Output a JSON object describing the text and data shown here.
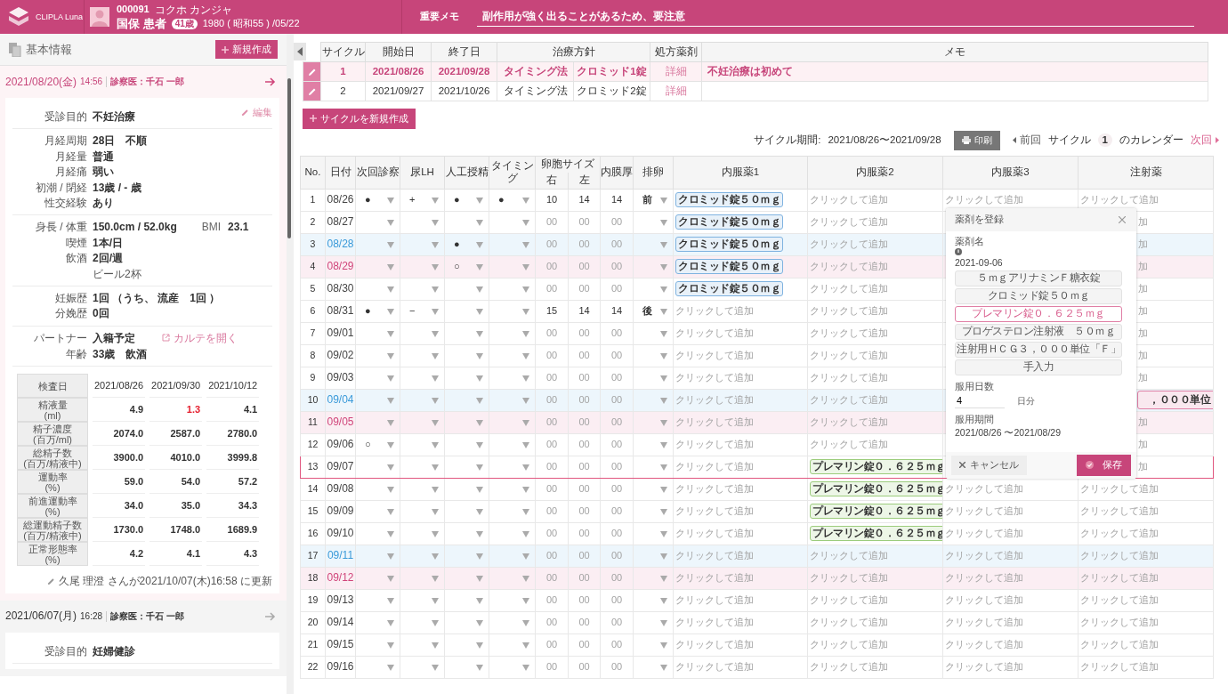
{
  "header": {
    "app_name": "CLIPLA Luna",
    "patient_id": "000091",
    "patient_kana": "コクホ カンジャ",
    "patient_name": "国保 患者",
    "age": "41歳",
    "birthday": "1980 ( 昭和55 ) /05/22",
    "memo_label": "重要メモ",
    "memo": "副作用が強く出ることがあるため、要注意"
  },
  "sidebar": {
    "title": "基本情報",
    "new_button": "新規作成",
    "records": [
      {
        "date": "2021/08/20(金)",
        "time": "14:56",
        "doctor": "診察医：千石 一郎",
        "current": true,
        "edit": "編集",
        "sections": [
          [
            {
              "label": "受診目的",
              "value": "不妊治療"
            }
          ],
          [
            {
              "label": "月経周期",
              "value": "28日　不順"
            },
            {
              "label": "月経量",
              "value": "普通"
            },
            {
              "label": "月経痛",
              "value": "弱い"
            },
            {
              "label": "初潮 / 閉経",
              "value": "13歳  /  - 歳"
            },
            {
              "label": "性交経験",
              "value": "あり"
            }
          ],
          [
            {
              "label": "身長 / 体重",
              "value": "150.0cm  /  52.0kg",
              "extra_label": "BMI",
              "extra_value": "23.1"
            },
            {
              "label": "喫煙",
              "value": "1本/日"
            },
            {
              "label": "飲酒",
              "value": "2回/週",
              "note": "ビール2杯"
            }
          ],
          [
            {
              "label": "妊娠歴",
              "value": "1回 （うち、 流産　1回 ）"
            },
            {
              "label": "分娩歴",
              "value": "0回"
            }
          ],
          [
            {
              "label": "パートナー",
              "value": "入籍予定",
              "link": "カルテを開く"
            },
            {
              "label": "年齢",
              "value": "33歳　飲酒"
            }
          ]
        ],
        "lab": {
          "corner": "検査日",
          "dates": [
            "2021/08/26",
            "2021/09/30",
            "2021/10/12"
          ],
          "rows": [
            {
              "label": "精液量",
              "unit": "(ml)",
              "values": [
                {
                  "v": "4.9",
                  "alert": false
                },
                {
                  "v": "1.3",
                  "alert": true
                },
                {
                  "v": "4.1",
                  "alert": false
                }
              ]
            },
            {
              "label": "精子濃度",
              "unit": "(百万/ml)",
              "values": [
                {
                  "v": "2074.0",
                  "alert": false
                },
                {
                  "v": "2587.0",
                  "alert": false
                },
                {
                  "v": "2780.0",
                  "alert": false
                }
              ]
            },
            {
              "label": "総精子数",
              "unit": "(百万/精液中)",
              "values": [
                {
                  "v": "3900.0",
                  "alert": false
                },
                {
                  "v": "4010.0",
                  "alert": false
                },
                {
                  "v": "3999.8",
                  "alert": false
                }
              ]
            },
            {
              "label": "運動率",
              "unit": "(%)",
              "values": [
                {
                  "v": "59.0",
                  "alert": false
                },
                {
                  "v": "54.0",
                  "alert": false
                },
                {
                  "v": "57.2",
                  "alert": false
                }
              ]
            },
            {
              "label": "前進運動率",
              "unit": "(%)",
              "values": [
                {
                  "v": "34.0",
                  "alert": false
                },
                {
                  "v": "35.0",
                  "alert": false
                },
                {
                  "v": "34.3",
                  "alert": false
                }
              ]
            },
            {
              "label": "総運動精子数",
              "unit": "(百万/精液中)",
              "values": [
                {
                  "v": "1730.0",
                  "alert": false
                },
                {
                  "v": "1748.0",
                  "alert": false
                },
                {
                  "v": "1689.9",
                  "alert": false
                }
              ]
            },
            {
              "label": "正常形態率",
              "unit": "(%)",
              "values": [
                {
                  "v": "4.2",
                  "alert": false
                },
                {
                  "v": "4.1",
                  "alert": false
                },
                {
                  "v": "4.3",
                  "alert": false
                }
              ]
            }
          ]
        },
        "updated": "久尾 理澄 さんが2021/10/07(木)16:58 に更新"
      },
      {
        "date": "2021/06/07(月)",
        "time": "16:28",
        "doctor": "診察医：千石 一郎",
        "current": false,
        "sections": [
          [
            {
              "label": "受診目的",
              "value": "妊婦健診"
            }
          ]
        ]
      }
    ]
  },
  "cycles": {
    "columns": [
      "サイクル",
      "開始日",
      "終了日",
      "治療方針",
      "処方薬剤",
      "メモ"
    ],
    "rows": [
      {
        "no": "1",
        "start": "2021/08/26",
        "end": "2021/09/28",
        "method": "タイミング法",
        "drug": "クロミッド1錠",
        "prescription": "詳細",
        "memo": "不妊治療は初めて",
        "selected": true
      },
      {
        "no": "2",
        "start": "2021/09/27",
        "end": "2021/10/26",
        "method": "タイミング法",
        "drug": "クロミッド2錠",
        "prescription": "詳細",
        "selected": false
      }
    ],
    "new_button": "サイクルを新規作成"
  },
  "toolbar": {
    "period_label": "サイクル期間:",
    "period": "2021/08/26〜2021/09/28",
    "print": "印刷",
    "prev": "前回",
    "cycle_label": "サイクル",
    "cycle_no": "1",
    "calendar_label": "のカレンダー",
    "next": "次回"
  },
  "calendar": {
    "columns": [
      "No.",
      "日付",
      "次回診察",
      "尿LH",
      "人工授精",
      "タイミング",
      "卵胞サイズ",
      "右",
      "左",
      "内膜厚",
      "排卵",
      "内服薬1",
      "内服薬2",
      "内服薬3",
      "注射薬"
    ],
    "rows": [
      {
        "no": "1",
        "date": "08/26",
        "color": "#444444",
        "weekend": false,
        "selected": false,
        "visit": "●",
        "lh": "+",
        "insemination": "●",
        "timing": "●",
        "sizes": [
          "10",
          "14",
          "14"
        ],
        "sizes_set": true,
        "ovulation": "前",
        "meds": [
          {
            "kind": "tag",
            "text": "クロミッド錠５０ｍｇ",
            "color": "#7fb3e0"
          },
          {
            "kind": "add",
            "text": "クリックして追加"
          },
          {
            "kind": "add",
            "text": "クリックして追加"
          },
          {
            "kind": "add",
            "text": "クリックして追加"
          }
        ]
      },
      {
        "no": "2",
        "date": "08/27",
        "color": "#444444",
        "weekend": false,
        "selected": false,
        "sizes": [
          "00",
          "00",
          "00"
        ],
        "sizes_set": false,
        "meds": [
          {
            "kind": "tag",
            "text": "クロミッド錠５０ｍｇ",
            "color": "#7fb3e0"
          },
          {
            "kind": "add",
            "text": "クリックして追加"
          },
          {
            "kind": "covered"
          },
          {
            "kind": "cut",
            "text": "加"
          }
        ]
      },
      {
        "no": "3",
        "date": "08/28",
        "color": "#3a9ad9",
        "weekend": true,
        "selected": false,
        "insemination": "●",
        "sizes": [
          "00",
          "00",
          "00"
        ],
        "sizes_set": false,
        "meds": [
          {
            "kind": "tag",
            "text": "クロミッド錠５０ｍｇ",
            "color": "#7fb3e0"
          },
          {
            "kind": "add",
            "text": "クリックして追加"
          },
          {
            "kind": "covered"
          },
          {
            "kind": "cut",
            "text": "加"
          }
        ]
      },
      {
        "no": "4",
        "date": "08/29",
        "color": "#d0457a",
        "weekend": true,
        "selected": false,
        "insemination": "○",
        "sizes": [
          "00",
          "00",
          "00"
        ],
        "sizes_set": false,
        "meds": [
          {
            "kind": "tag",
            "text": "クロミッド錠５０ｍｇ",
            "color": "#7fb3e0"
          },
          {
            "kind": "add",
            "text": "クリックして追加"
          },
          {
            "kind": "covered"
          },
          {
            "kind": "cut",
            "text": "加"
          }
        ]
      },
      {
        "no": "5",
        "date": "08/30",
        "color": "#444444",
        "weekend": false,
        "selected": false,
        "sizes": [
          "00",
          "00",
          "00"
        ],
        "sizes_set": false,
        "meds": [
          {
            "kind": "tag",
            "text": "クロミッド錠５０ｍｇ",
            "color": "#7fb3e0"
          },
          {
            "kind": "add",
            "text": "クリックして追加"
          },
          {
            "kind": "covered"
          },
          {
            "kind": "cut",
            "text": "加"
          }
        ]
      },
      {
        "no": "6",
        "date": "08/31",
        "color": "#444444",
        "weekend": false,
        "selected": false,
        "visit": "●",
        "lh": "−",
        "sizes": [
          "15",
          "14",
          "14"
        ],
        "sizes_set": true,
        "ovulation": "後",
        "meds": [
          {
            "kind": "add",
            "text": "クリックして追加"
          },
          {
            "kind": "add",
            "text": "クリックして追加"
          },
          {
            "kind": "covered"
          },
          {
            "kind": "cut",
            "text": "加"
          }
        ]
      },
      {
        "no": "7",
        "date": "09/01",
        "color": "#444444",
        "weekend": false,
        "selected": false,
        "sizes": [
          "00",
          "00",
          "00"
        ],
        "sizes_set": false,
        "meds": [
          {
            "kind": "add",
            "text": "クリックして追加"
          },
          {
            "kind": "add",
            "text": "クリックして追加"
          },
          {
            "kind": "covered"
          },
          {
            "kind": "cut",
            "text": "加"
          }
        ]
      },
      {
        "no": "8",
        "date": "09/02",
        "color": "#444444",
        "weekend": false,
        "selected": false,
        "sizes": [
          "00",
          "00",
          "00"
        ],
        "sizes_set": false,
        "meds": [
          {
            "kind": "add",
            "text": "クリックして追加"
          },
          {
            "kind": "add",
            "text": "クリックして追加"
          },
          {
            "kind": "covered"
          },
          {
            "kind": "cut",
            "text": "加"
          }
        ]
      },
      {
        "no": "9",
        "date": "09/03",
        "color": "#444444",
        "weekend": false,
        "selected": false,
        "sizes": [
          "00",
          "00",
          "00"
        ],
        "sizes_set": false,
        "meds": [
          {
            "kind": "add",
            "text": "クリックして追加"
          },
          {
            "kind": "add",
            "text": "クリックして追加"
          },
          {
            "kind": "covered"
          },
          {
            "kind": "cut",
            "text": "加"
          }
        ]
      },
      {
        "no": "10",
        "date": "09/04",
        "color": "#3a9ad9",
        "weekend": true,
        "selected": false,
        "sizes": [
          "00",
          "00",
          "00"
        ],
        "sizes_set": false,
        "meds": [
          {
            "kind": "add",
            "text": "クリックして追加"
          },
          {
            "kind": "add",
            "text": "クリックして追加"
          },
          {
            "kind": "covered"
          },
          {
            "kind": "cut_tag",
            "text": "，０００単位",
            "color": "#e07fa5"
          }
        ]
      },
      {
        "no": "11",
        "date": "09/05",
        "color": "#d0457a",
        "weekend": true,
        "selected": false,
        "sizes": [
          "00",
          "00",
          "00"
        ],
        "sizes_set": false,
        "meds": [
          {
            "kind": "add",
            "text": "クリックして追加"
          },
          {
            "kind": "add",
            "text": "クリックして追加"
          },
          {
            "kind": "covered"
          },
          {
            "kind": "cut",
            "text": "加"
          }
        ]
      },
      {
        "no": "12",
        "date": "09/06",
        "color": "#444444",
        "weekend": false,
        "selected": false,
        "visit": "○",
        "sizes": [
          "00",
          "00",
          "00"
        ],
        "sizes_set": false,
        "meds": [
          {
            "kind": "add",
            "text": "クリックして追加"
          },
          {
            "kind": "add",
            "text": "クリックして追加"
          },
          {
            "kind": "covered"
          },
          {
            "kind": "cut",
            "text": "加"
          }
        ]
      },
      {
        "no": "13",
        "date": "09/07",
        "color": "#444444",
        "weekend": false,
        "selected": true,
        "sizes": [
          "00",
          "00",
          "00"
        ],
        "sizes_set": false,
        "meds": [
          {
            "kind": "add",
            "text": "クリックして追加"
          },
          {
            "kind": "tag",
            "text": "プレマリン錠０．６２５ｍｇ",
            "color": "#9ccc7c"
          },
          {
            "kind": "covered"
          },
          {
            "kind": "cut",
            "text": "加"
          }
        ]
      },
      {
        "no": "14",
        "date": "09/08",
        "color": "#444444",
        "weekend": false,
        "selected": false,
        "sizes": [
          "00",
          "00",
          "00"
        ],
        "sizes_set": false,
        "meds": [
          {
            "kind": "add",
            "text": "クリックして追加"
          },
          {
            "kind": "tag",
            "text": "プレマリン錠０．６２５ｍｇ",
            "color": "#9ccc7c"
          },
          {
            "kind": "add",
            "text": "クリックして追加"
          },
          {
            "kind": "add",
            "text": "クリックして追加"
          }
        ]
      },
      {
        "no": "15",
        "date": "09/09",
        "color": "#444444",
        "weekend": false,
        "selected": false,
        "sizes": [
          "00",
          "00",
          "00"
        ],
        "sizes_set": false,
        "meds": [
          {
            "kind": "add",
            "text": "クリックして追加"
          },
          {
            "kind": "tag",
            "text": "プレマリン錠０．６２５ｍｇ",
            "color": "#9ccc7c"
          },
          {
            "kind": "add",
            "text": "クリックして追加"
          },
          {
            "kind": "add",
            "text": "クリックして追加"
          }
        ]
      },
      {
        "no": "16",
        "date": "09/10",
        "color": "#444444",
        "weekend": false,
        "selected": false,
        "sizes": [
          "00",
          "00",
          "00"
        ],
        "sizes_set": false,
        "meds": [
          {
            "kind": "add",
            "text": "クリックして追加"
          },
          {
            "kind": "tag",
            "text": "プレマリン錠０．６２５ｍｇ",
            "color": "#9ccc7c"
          },
          {
            "kind": "add",
            "text": "クリックして追加"
          },
          {
            "kind": "add",
            "text": "クリックして追加"
          }
        ]
      },
      {
        "no": "17",
        "date": "09/11",
        "color": "#3a9ad9",
        "weekend": true,
        "selected": false,
        "sizes": [
          "00",
          "00",
          "00"
        ],
        "sizes_set": false,
        "meds": [
          {
            "kind": "add",
            "text": "クリックして追加"
          },
          {
            "kind": "add",
            "text": "クリックして追加"
          },
          {
            "kind": "add",
            "text": "クリックして追加"
          },
          {
            "kind": "add",
            "text": "クリックして追加"
          }
        ]
      },
      {
        "no": "18",
        "date": "09/12",
        "color": "#d0457a",
        "weekend": true,
        "selected": false,
        "sizes": [
          "00",
          "00",
          "00"
        ],
        "sizes_set": false,
        "meds": [
          {
            "kind": "add",
            "text": "クリックして追加"
          },
          {
            "kind": "add",
            "text": "クリックして追加"
          },
          {
            "kind": "add",
            "text": "クリックして追加"
          },
          {
            "kind": "add",
            "text": "クリックして追加"
          }
        ]
      },
      {
        "no": "19",
        "date": "09/13",
        "color": "#444444",
        "weekend": false,
        "selected": false,
        "sizes": [
          "00",
          "00",
          "00"
        ],
        "sizes_set": false,
        "meds": [
          {
            "kind": "add",
            "text": "クリックして追加"
          },
          {
            "kind": "add",
            "text": "クリックして追加"
          },
          {
            "kind": "add",
            "text": "クリックして追加"
          },
          {
            "kind": "add",
            "text": "クリックして追加"
          }
        ]
      },
      {
        "no": "20",
        "date": "09/14",
        "color": "#444444",
        "weekend": false,
        "selected": false,
        "sizes": [
          "00",
          "00",
          "00"
        ],
        "sizes_set": false,
        "meds": [
          {
            "kind": "add",
            "text": "クリックして追加"
          },
          {
            "kind": "add",
            "text": "クリックして追加"
          },
          {
            "kind": "add",
            "text": "クリックして追加"
          },
          {
            "kind": "add",
            "text": "クリックして追加"
          }
        ]
      },
      {
        "no": "21",
        "date": "09/15",
        "color": "#444444",
        "weekend": false,
        "selected": false,
        "sizes": [
          "00",
          "00",
          "00"
        ],
        "sizes_set": false,
        "meds": [
          {
            "kind": "add",
            "text": "クリックして追加"
          },
          {
            "kind": "add",
            "text": "クリックして追加"
          },
          {
            "kind": "add",
            "text": "クリックして追加"
          },
          {
            "kind": "add",
            "text": "クリックして追加"
          }
        ]
      },
      {
        "no": "22",
        "date": "09/16",
        "color": "#444444",
        "weekend": false,
        "selected": false,
        "sizes": [
          "00",
          "00",
          "00"
        ],
        "sizes_set": false,
        "meds": [
          {
            "kind": "add",
            "text": "クリックして追加"
          },
          {
            "kind": "add",
            "text": "クリックして追加"
          },
          {
            "kind": "add",
            "text": "クリックして追加"
          },
          {
            "kind": "add",
            "text": "クリックして追加"
          }
        ]
      }
    ]
  },
  "dialog": {
    "title": "薬剤を登録",
    "drug_label": "薬剤名",
    "date": "2021-09-06",
    "options": [
      {
        "text": "５ｍｇアリナミンＦ糖衣錠",
        "selected": false
      },
      {
        "text": "クロミッド錠５０ｍｇ",
        "selected": false
      },
      {
        "text": "プレマリン錠０．６２５ｍｇ",
        "selected": true
      },
      {
        "text": "プロゲステロン注射液　５０ｍｇ",
        "selected": false
      },
      {
        "text": "注射用ＨＣＧ３，０００単位「Ｆ」",
        "selected": false
      },
      {
        "text": "手入力",
        "selected": false
      }
    ],
    "days_label": "服用日数",
    "days": "4",
    "days_unit": "日分",
    "period_label": "服用期間",
    "period": "2021/08/26 〜2021/08/29",
    "cancel": "キャンセル",
    "save": "保存"
  }
}
